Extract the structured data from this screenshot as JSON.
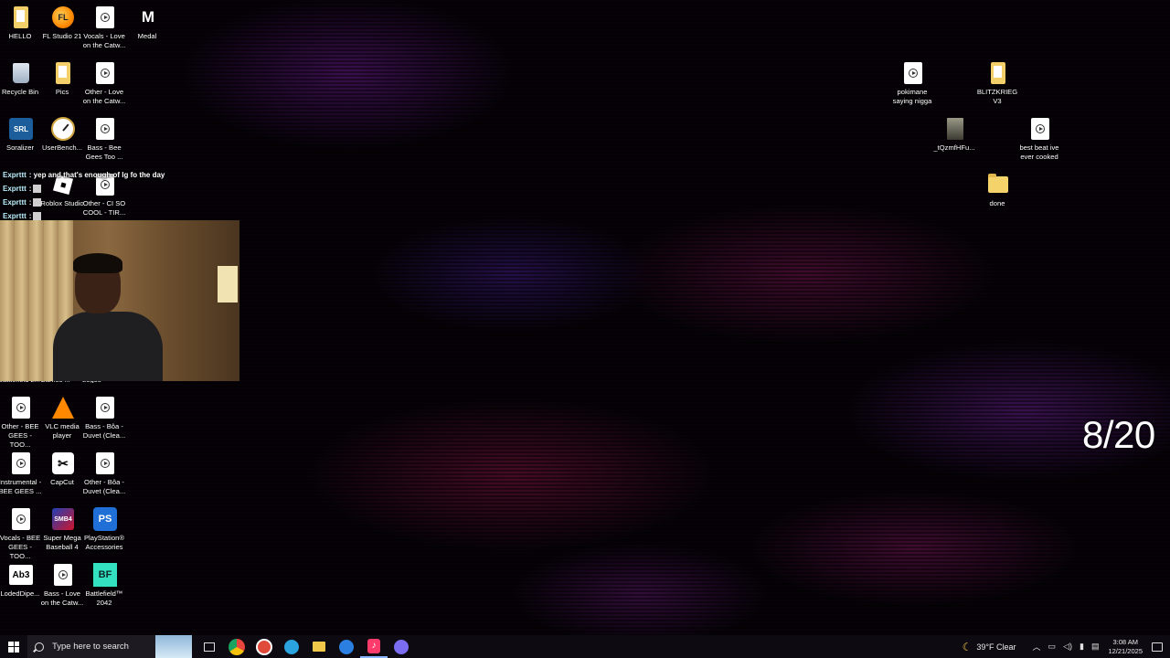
{
  "desktop_icons": {
    "hello": "HELLO",
    "fl_studio": "FL Studio 21",
    "vocals_love_catwalk": "Vocals - Love on the Catw...",
    "medal": "Medal",
    "recycle_bin": "Recycle Bin",
    "pics": "Pics",
    "other_love_catwalk": "Other - Love on the Catw...",
    "soralizer": "Soralizer",
    "userbench": "UserBench...",
    "bass_bee_gees": "Bass - Bee Gees Too ...",
    "roblox_studio": "Roblox Studio",
    "other_ci_so_cool": "Other - CI SO COOL - TIR...",
    "partial_left": "Battlefield 2...",
    "partial_mid": "Games ...",
    "partial_right": "Logos",
    "other_bee_gees": "Other - BEE GEES - TOO...",
    "vlc": "VLC media player",
    "bass_boa_duvet": "Bass - Bôa - Duvet (Clea...",
    "instrumental_bee_gees": "Instrumental - BEE GEES ...",
    "capcut": "CapCut",
    "other_boa_duvet": "Other - Bôa - Duvet (Clea...",
    "vocals_bee_gees": "Vocals - BEE GEES - TOO...",
    "super_mega_baseball": "Super Mega Baseball 4",
    "playstation_accessories": "PlayStation® Accessories",
    "loded_diper": "LodedDipe...",
    "bass_love_catwalk": "Bass - Love on the Catw...",
    "battlefield_2042": "Battlefield™ 2042",
    "pokimane": "pokimane saying nigga",
    "blitzkrieg": "BLITZKRIEG V3",
    "tqzmfhfu": "_tQzmfHFu...",
    "best_beat": "best beat ive ever cooked",
    "done": "done"
  },
  "icon_glyph_text": {
    "fl": "FL",
    "medal": "M",
    "soralizer": "SRL",
    "capcut": "✂",
    "smb": "SMB4",
    "ps": "PS",
    "ab3": "Ab3",
    "bf": "BF"
  },
  "chat": {
    "messages": [
      {
        "user": "Exprttt",
        "text": ": yep and that's enough of lg fo the day"
      },
      {
        "user": "Exprttt",
        "text": ":"
      },
      {
        "user": "Exprttt",
        "text": ":"
      },
      {
        "user": "Exprttt",
        "text": ":"
      }
    ]
  },
  "overlay": {
    "counter": "8/20"
  },
  "taskbar": {
    "search_placeholder": "Type here to search",
    "weather": "39°F  Clear",
    "time": "3:08 AM",
    "date": "12/21/2025",
    "music_glyph": "♪"
  },
  "icons": {
    "start": "windows-logo-icon",
    "search": "search-icon",
    "taskview": "task-view-icon",
    "chrome": "chrome-icon",
    "steam": "steam-icon",
    "telegram": "telegram-icon",
    "explorer": "file-explorer-icon",
    "edge": "browser-icon",
    "music": "music-app-icon",
    "discord": "discord-icon"
  },
  "colors": {
    "wallpaper_base": "#060208",
    "wallpaper_magenta": "#b0207a",
    "wallpaper_violet": "#6a2fb8",
    "taskbar": "#0e0a12",
    "counter_text": "#ffffff"
  }
}
